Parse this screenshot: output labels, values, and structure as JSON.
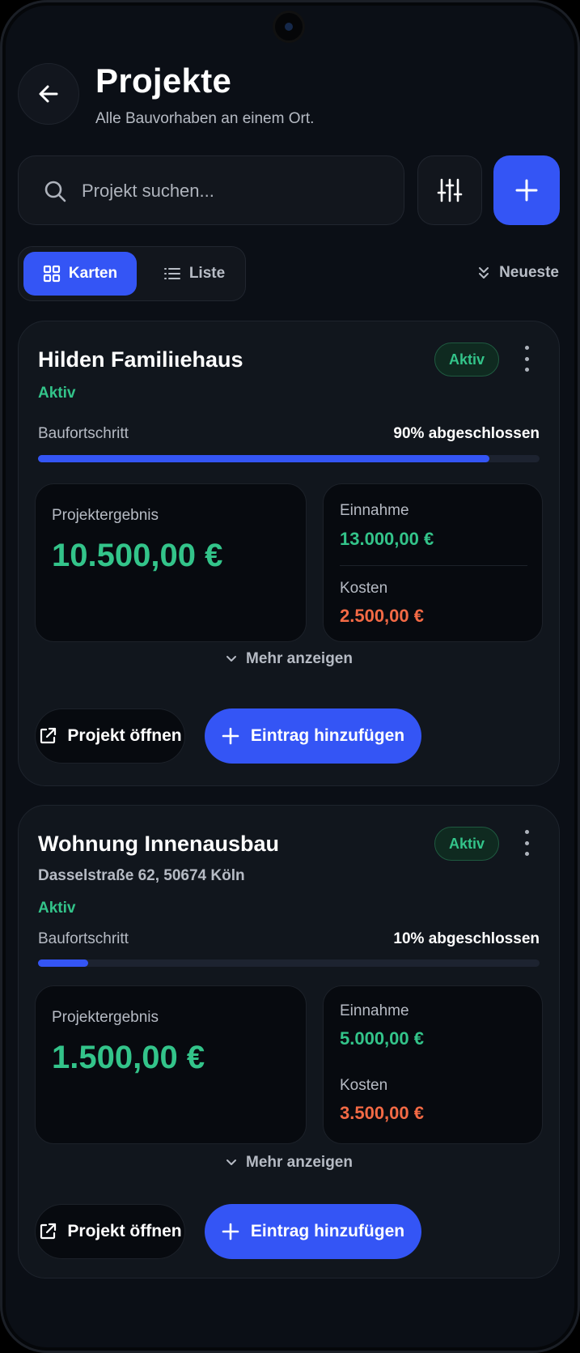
{
  "header": {
    "title": "Projekte",
    "subtitle": "Alle Bauvorhaben an einem Ort."
  },
  "search": {
    "placeholder": "Projekt suchen..."
  },
  "view_toggle": {
    "cards_label": "Karten",
    "list_label": "Liste",
    "active": "Karten"
  },
  "sort": {
    "label": "Neueste"
  },
  "colors": {
    "accent": "#3455f5",
    "positive": "#33c48a",
    "negative": "#f36a45"
  },
  "projects": [
    {
      "name": "Hilden Familiιehaus",
      "badge": "Aktiv",
      "address": "",
      "status": "Aktiv",
      "progress_label": "Baufortschritt",
      "progress_text": "90% abgeschlossen",
      "progress_percent": 90,
      "result_label": "Projektergebnis",
      "result_value": "10.500,00 €",
      "income_label": "Einnahme",
      "income_value": "13.000,00 €",
      "cost_label": "Kosten",
      "cost_value": "2.500,00 €",
      "more_label": "Mehr anzeigen",
      "open_label": "Projekt öffnen",
      "add_entry_label": "Eintrag hinzufügen"
    },
    {
      "name": "Wohnung Innenausbau",
      "badge": "Aktiv",
      "address": "Dasselstraße 62, 50674 Köln",
      "status": "Aktiv",
      "progress_label": "Baufortschritt",
      "progress_text": "10% abgeschlossen",
      "progress_percent": 10,
      "result_label": "Projektergebnis",
      "result_value": "1.500,00 €",
      "income_label": "Einnahme",
      "income_value": "5.000,00 €",
      "cost_label": "Kosten",
      "cost_value": "3.500,00 €",
      "more_label": "Mehr anzeigen",
      "open_label": "Projekt öffnen",
      "add_entry_label": "Eintrag hinzufügen"
    }
  ]
}
